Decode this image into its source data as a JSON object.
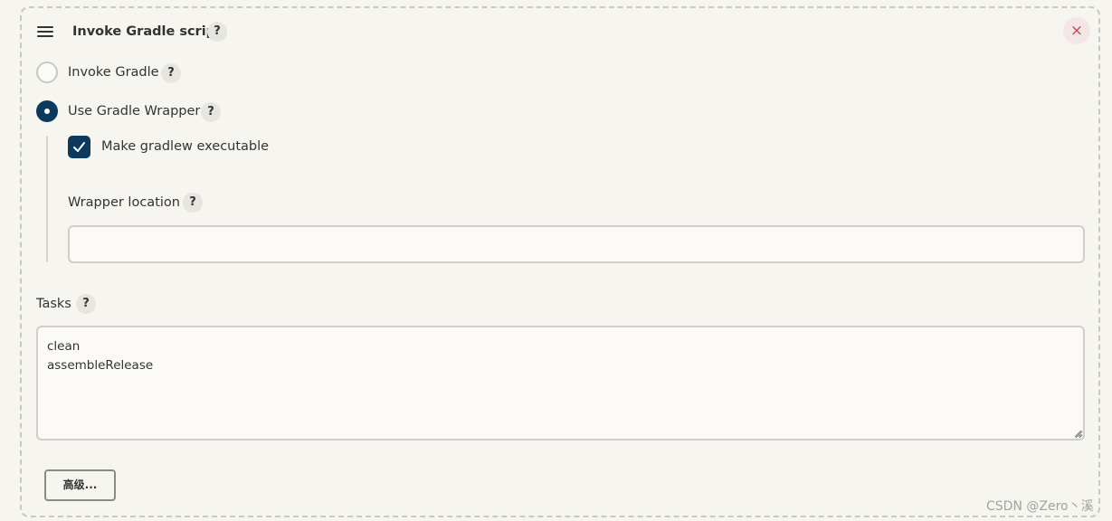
{
  "section": {
    "title": "Invoke Gradle script",
    "help": "?",
    "close_glyph": "×"
  },
  "options": {
    "invoke_gradle": {
      "label": "Invoke Gradle",
      "selected": false,
      "help": "?"
    },
    "use_wrapper": {
      "label": "Use Gradle Wrapper",
      "selected": true,
      "help": "?"
    }
  },
  "wrapper": {
    "make_executable_label": "Make gradlew executable",
    "make_executable_checked": true,
    "location_label": "Wrapper location",
    "location_help": "?",
    "location_value": ""
  },
  "tasks": {
    "label": "Tasks",
    "help": "?",
    "value": "clean\nassembleRelease"
  },
  "advanced_button": "高级...",
  "watermark": "CSDN @Zero丶溪",
  "colors": {
    "accent": "#0b3a5d",
    "close": "#c9485b",
    "background": "#f6f5f0"
  },
  "icons": {
    "drag": "drag-handle-icon",
    "close": "close-icon",
    "check": "check-icon"
  }
}
